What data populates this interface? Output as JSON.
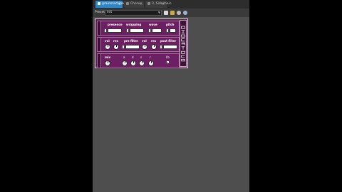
{
  "tabs": [
    {
      "label": "grainmachine"
    },
    {
      "label": "Chorus"
    },
    {
      "label": "3. Sidechain"
    }
  ],
  "presets": {
    "label": "Presets",
    "value": "Init"
  },
  "toolbar_icons": [
    "save-icon",
    "folder-icon",
    "settings-icon",
    "help-icon"
  ],
  "plugin": {
    "row1": {
      "labels": [
        "presence",
        "wrapping",
        "wave",
        "pitch"
      ]
    },
    "row2": {
      "labels": [
        "vol",
        "res",
        "pre filter",
        "vol",
        "res",
        "post filter"
      ]
    },
    "row3": {
      "labels": [
        "mix",
        "a",
        "d",
        "s",
        "r",
        "lfo"
      ]
    }
  },
  "colors": {
    "accent": "#2e86c8",
    "plugin_bg": "#5c1a52",
    "plugin_row": "#6d1f63"
  }
}
